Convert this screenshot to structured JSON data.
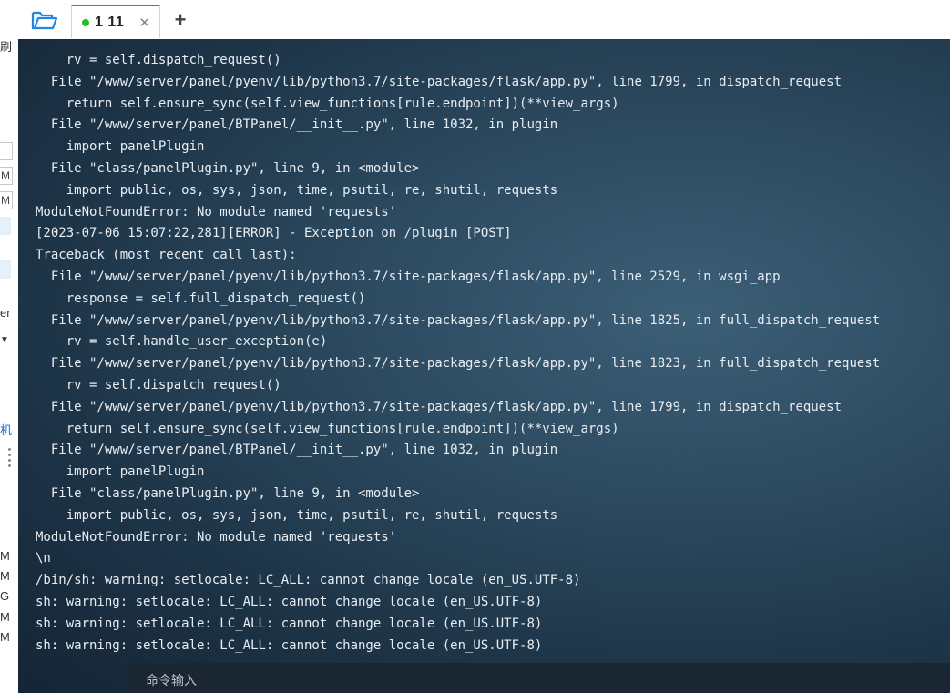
{
  "app": {
    "tab": {
      "label": "1 11",
      "status_color": "#20c020"
    },
    "icons": {
      "open": "folder-open-icon",
      "close": "close-icon",
      "add": "plus-icon"
    }
  },
  "left_strip": {
    "frags": [
      "刷",
      "M",
      "M",
      "er",
      "机",
      "M",
      "M",
      "G",
      "M",
      "M"
    ]
  },
  "terminal": {
    "lines": [
      "    rv = self.dispatch_request()",
      "  File \"/www/server/panel/pyenv/lib/python3.7/site-packages/flask/app.py\", line 1799, in dispatch_request",
      "    return self.ensure_sync(self.view_functions[rule.endpoint])(**view_args)",
      "  File \"/www/server/panel/BTPanel/__init__.py\", line 1032, in plugin",
      "    import panelPlugin",
      "  File \"class/panelPlugin.py\", line 9, in <module>",
      "    import public, os, sys, json, time, psutil, re, shutil, requests",
      "ModuleNotFoundError: No module named 'requests'",
      "[2023-07-06 15:07:22,281][ERROR] - Exception on /plugin [POST]",
      "Traceback (most recent call last):",
      "  File \"/www/server/panel/pyenv/lib/python3.7/site-packages/flask/app.py\", line 2529, in wsgi_app",
      "    response = self.full_dispatch_request()",
      "  File \"/www/server/panel/pyenv/lib/python3.7/site-packages/flask/app.py\", line 1825, in full_dispatch_request",
      "    rv = self.handle_user_exception(e)",
      "  File \"/www/server/panel/pyenv/lib/python3.7/site-packages/flask/app.py\", line 1823, in full_dispatch_request",
      "    rv = self.dispatch_request()",
      "  File \"/www/server/panel/pyenv/lib/python3.7/site-packages/flask/app.py\", line 1799, in dispatch_request",
      "    return self.ensure_sync(self.view_functions[rule.endpoint])(**view_args)",
      "  File \"/www/server/panel/BTPanel/__init__.py\", line 1032, in plugin",
      "    import panelPlugin",
      "  File \"class/panelPlugin.py\", line 9, in <module>",
      "    import public, os, sys, json, time, psutil, re, shutil, requests",
      "ModuleNotFoundError: No module named 'requests'",
      "\\n",
      "/bin/sh: warning: setlocale: LC_ALL: cannot change locale (en_US.UTF-8)",
      "sh: warning: setlocale: LC_ALL: cannot change locale (en_US.UTF-8)",
      "sh: warning: setlocale: LC_ALL: cannot change locale (en_US.UTF-8)",
      "sh: warning: setlocale: LC_ALL: cannot change locale (en_US.UTF-8)"
    ],
    "command_placeholder": "命令输入"
  }
}
